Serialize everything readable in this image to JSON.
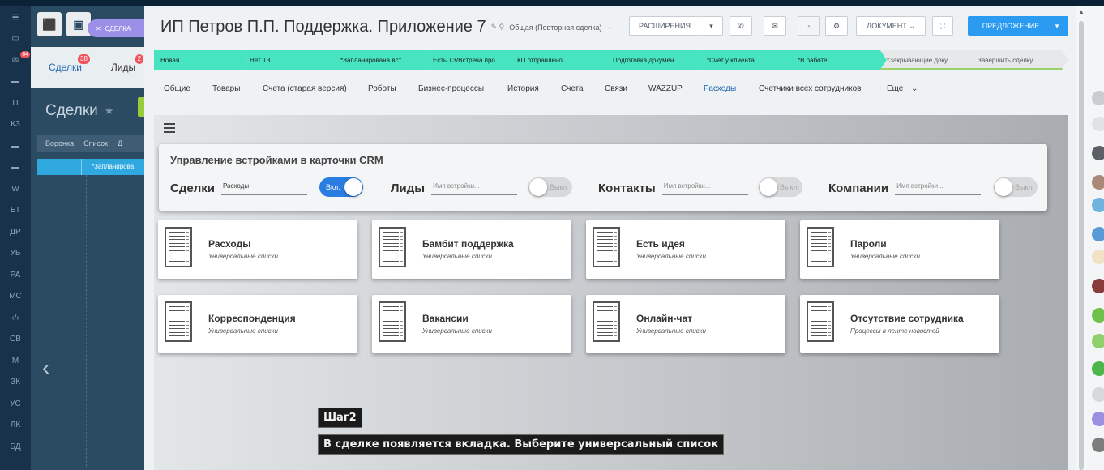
{
  "left_rail": {
    "menu_icon": "menu-icon",
    "items": [
      {
        "label": "≡",
        "big": true
      },
      {
        "label": "▭",
        "big": false
      },
      {
        "label": "✉",
        "badge": "64"
      },
      {
        "label": "▬",
        "big": false
      },
      {
        "label": "П"
      },
      {
        "label": "КЗ"
      },
      {
        "label": "▬"
      },
      {
        "label": "▬"
      },
      {
        "label": "W"
      },
      {
        "label": "БТ"
      },
      {
        "label": "ДР"
      },
      {
        "label": "УБ"
      },
      {
        "label": "РА"
      },
      {
        "label": "МС"
      },
      {
        "label": "‹/›"
      },
      {
        "label": "СВ"
      },
      {
        "label": "М"
      },
      {
        "label": "ЗК"
      },
      {
        "label": "УС"
      },
      {
        "label": "ЛК"
      },
      {
        "label": "БД"
      }
    ]
  },
  "background": {
    "close_label": "СДЕЛКА",
    "tabs": [
      {
        "label": "Сделки",
        "badge": "38"
      },
      {
        "label": "Лиды",
        "badge": "2"
      }
    ],
    "page_title": "Сделки",
    "view_tabs": [
      "Воронка",
      "Список",
      "Д"
    ],
    "stage_label": "*Запланирова"
  },
  "header": {
    "title": "ИП Петров П.П. Поддержка. Приложение 7",
    "subtitle": "Общая (Повторная сделка)",
    "buttons": {
      "extensions": "РАСШИРЕНИЯ",
      "document": "ДОКУМЕНТ",
      "offer": "ПРЕДЛОЖЕНИЕ"
    }
  },
  "stages": [
    {
      "label": "Новая",
      "color": "#47e4c2"
    },
    {
      "label": "Нет ТЗ",
      "color": "#47e4c2"
    },
    {
      "label": "*Запланирована вст...",
      "color": "#47e4c2"
    },
    {
      "label": "Есть ТЗ/Встреча про...",
      "color": "#47e4c2"
    },
    {
      "label": "КП отправлено",
      "color": "#47e4c2"
    },
    {
      "label": "Подготовка докумен...",
      "color": "#47e4c2"
    },
    {
      "label": "*Счет у клиента",
      "color": "#47e4c2"
    },
    {
      "label": "*В работе",
      "color": "#47e4c2"
    },
    {
      "label": "*Закрывающие доку...",
      "color": "#e6e8ea"
    },
    {
      "label": "Завершить сделку",
      "color": "#e6e8ea"
    }
  ],
  "tabs": [
    {
      "label": "Общие"
    },
    {
      "label": "Товары"
    },
    {
      "label": "Счета (старая версия)"
    },
    {
      "label": "Роботы"
    },
    {
      "label": "Бизнес-процессы"
    },
    {
      "label": "История"
    },
    {
      "label": "Счета"
    },
    {
      "label": "Связи"
    },
    {
      "label": "WAZZUP"
    },
    {
      "label": "Расходы",
      "active": true
    },
    {
      "label": "Счетчики всех сотрудников"
    },
    {
      "label": "Еще"
    }
  ],
  "manager": {
    "title": "Управление встройками в карточки CRM",
    "groups": [
      {
        "label": "Сделки",
        "value": "Расходы",
        "toggle": "Вкл.",
        "on": true
      },
      {
        "label": "Лиды",
        "placeholder": "Имя встройки...",
        "toggle": "Выкл",
        "on": false
      },
      {
        "label": "Контакты",
        "placeholder": "Имя встройки...",
        "toggle": "Выкл",
        "on": false
      },
      {
        "label": "Компании",
        "placeholder": "Имя встройки...",
        "toggle": "Выкл",
        "on": false
      }
    ]
  },
  "cards": [
    {
      "name": "Расходы",
      "desc": "Универсальные списки"
    },
    {
      "name": "Бамбит поддержка",
      "desc": "Универсальные списки"
    },
    {
      "name": "Есть идея",
      "desc": "Универсальные списки"
    },
    {
      "name": "Пароли",
      "desc": "Универсальные списки"
    },
    {
      "name": "Корреспонденция",
      "desc": "Универсальные списки"
    },
    {
      "name": "Вакансии",
      "desc": "Универсальные списки"
    },
    {
      "name": "Онлайн-чат",
      "desc": "Универсальные списки"
    },
    {
      "name": "Отсутствие сотрудника",
      "desc": "Процессы в ленте новостей"
    }
  ],
  "tooltip": {
    "step": "Шаг2",
    "text": "В сделке появляется вкладка. Выберите универсальный список"
  },
  "colors": {
    "accent": "#2a7de1",
    "stage_active": "#47e4c2",
    "offer_button": "#2a9bf0"
  }
}
